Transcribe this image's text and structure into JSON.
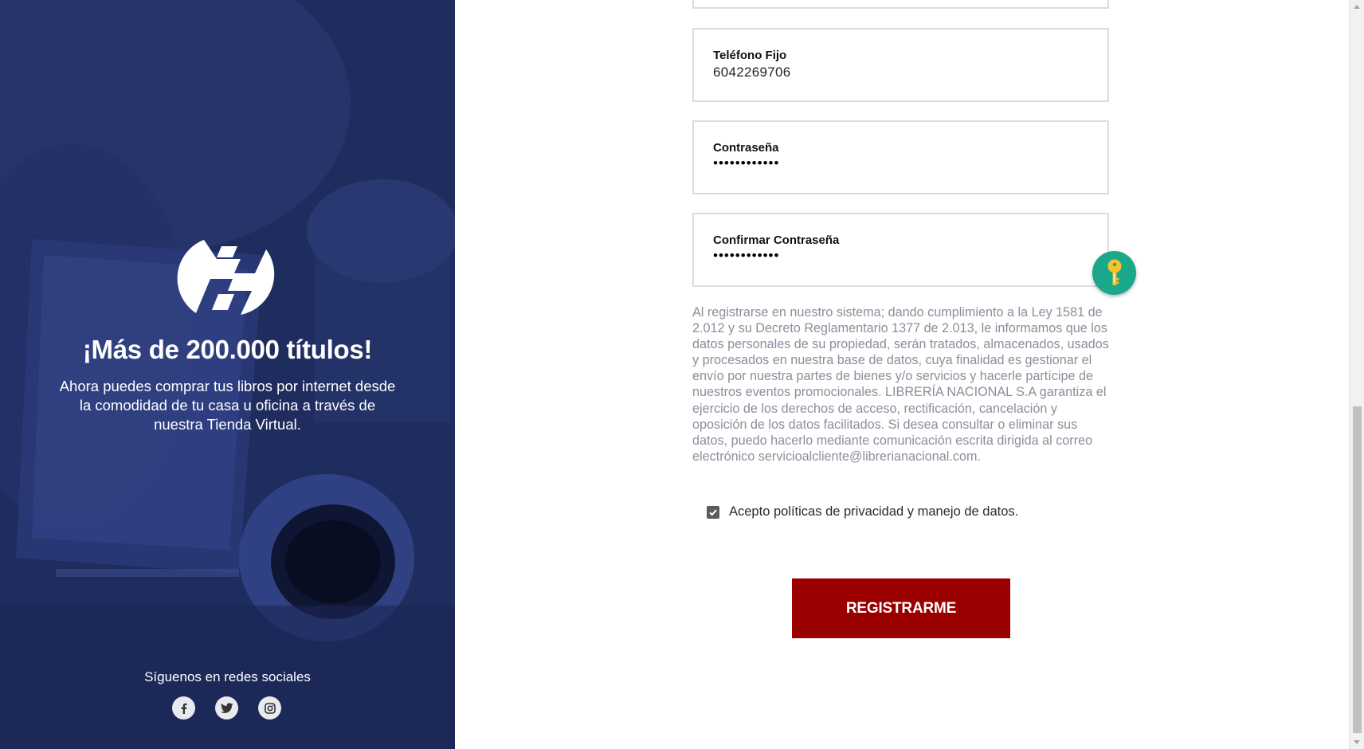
{
  "left": {
    "headline": "¡Más de 200.000 títulos!",
    "description": "Ahora puedes comprar tus libros por internet desde la comodidad de tu casa u oficina a través de nuestra Tienda Virtual.",
    "social_title": "Síguenos en redes sociales",
    "social": [
      {
        "name": "facebook-icon"
      },
      {
        "name": "twitter-icon"
      },
      {
        "name": "instagram-icon"
      }
    ],
    "brand_color": "#1f2c5e"
  },
  "form": {
    "phone": {
      "label": "Teléfono Fijo",
      "value": "6042269706"
    },
    "password": {
      "label": "Contraseña",
      "value": "••••••••••••"
    },
    "confirm_password": {
      "label": "Confirmar Contraseña",
      "value": "••••••••••••"
    },
    "legal_text": "Al registrarse en nuestro sistema; dando cumplimiento a la Ley 1581 de 2.012 y su Decreto Reglamentario 1377 de 2.013, le informamos que los datos personales de su propiedad, serán tratados, almacenados, usados y procesados en nuestra base de datos, cuya finalidad es gestionar el envío por nuestra partes de bienes y/o servicios y hacerle partícipe de nuestros eventos promocionales. LIBRERÍA NACIONAL S.A garantiza el ejercicio de los derechos de acceso, rectificación, cancelación y oposición de los datos facilitados. Si desea consultar o eliminar sus datos, puedo hacerlo mediante comunicación escrita dirigida al correo electrónico servicioalcliente@librerianacional.com.",
    "consent_label": "Acepto políticas de privacidad y manejo de datos.",
    "consent_checked": true,
    "submit_label": "REGISTRARME",
    "submit_color": "#9a0000",
    "key_badge_color": "#1aa88a"
  }
}
